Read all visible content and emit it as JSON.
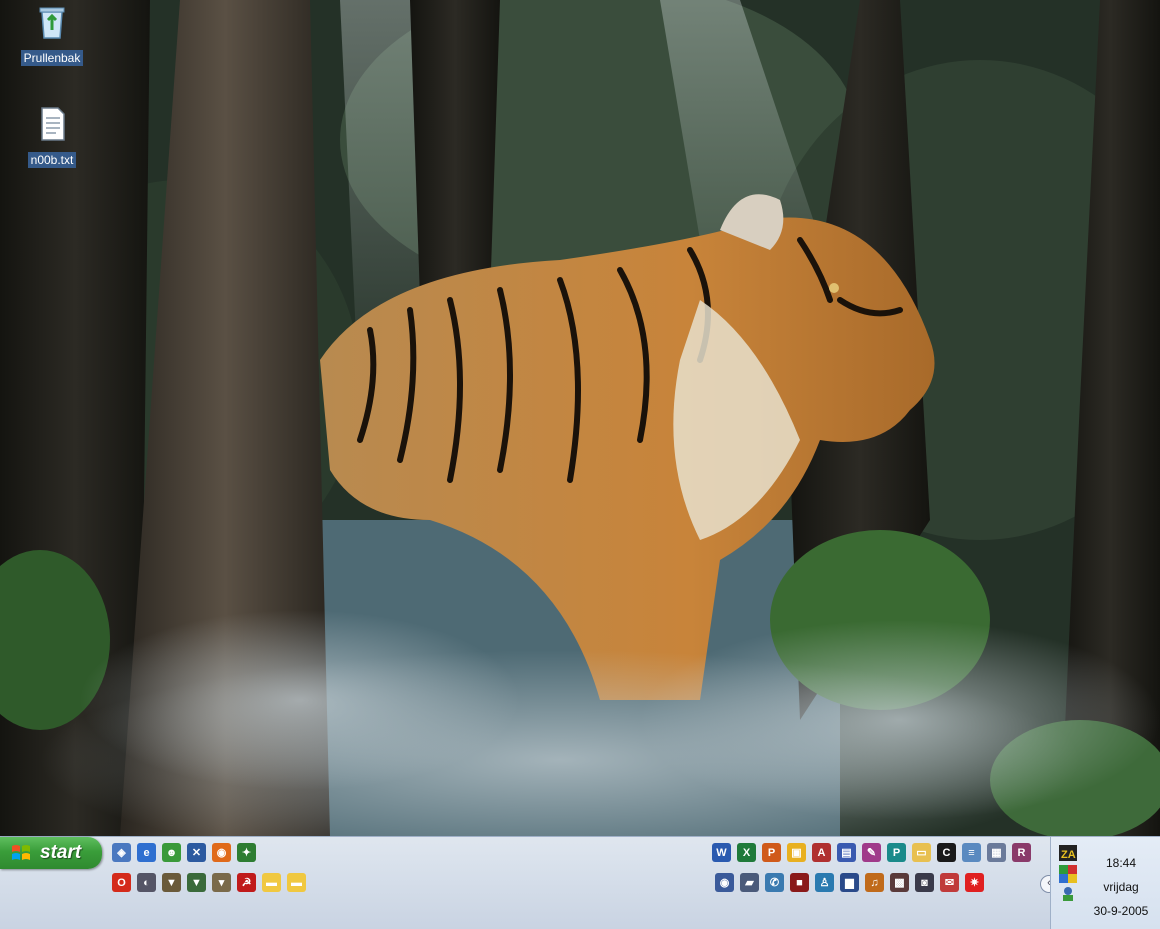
{
  "desktop": {
    "icons": [
      {
        "label": "Prullenbak",
        "icon": "recycle-bin-icon"
      },
      {
        "label": "n00b.txt",
        "icon": "text-file-icon"
      }
    ]
  },
  "taskbar": {
    "start_label": "start",
    "quick_launch_row1": [
      {
        "icon": "network-icon",
        "color": "#4a78c0",
        "glyph": "◈"
      },
      {
        "icon": "internet-explorer-icon",
        "color": "#2f6fd0",
        "glyph": "e"
      },
      {
        "icon": "messenger-icon",
        "color": "#3a9a3a",
        "glyph": "☻"
      },
      {
        "icon": "tool-icon",
        "color": "#2c5aa0",
        "glyph": "✕"
      },
      {
        "icon": "firefox-icon",
        "color": "#e06a1a",
        "glyph": "◉"
      },
      {
        "icon": "game-icon",
        "color": "#2e7d32",
        "glyph": "✦"
      }
    ],
    "quick_launch_row2": [
      {
        "icon": "opera-icon",
        "color": "#d42a1a",
        "glyph": "O"
      },
      {
        "icon": "media-icon",
        "color": "#555566",
        "glyph": "◐"
      },
      {
        "icon": "game-wings-icon",
        "color": "#6a5a3a",
        "glyph": "▼"
      },
      {
        "icon": "game-emblem-icon",
        "color": "#3a6a3a",
        "glyph": "▼"
      },
      {
        "icon": "game-wings2-icon",
        "color": "#7a6a4a",
        "glyph": "▾"
      },
      {
        "icon": "hammer-sickle-icon",
        "color": "#c01a1a",
        "glyph": "☭"
      },
      {
        "icon": "folder-icon",
        "color": "#f0c840",
        "glyph": "▬"
      },
      {
        "icon": "folder2-icon",
        "color": "#f0c840",
        "glyph": "▬"
      }
    ],
    "apps_row1": [
      {
        "icon": "word-icon",
        "color": "#2a5ab0",
        "glyph": "W"
      },
      {
        "icon": "excel-icon",
        "color": "#1f7a3a",
        "glyph": "X"
      },
      {
        "icon": "powerpoint-icon",
        "color": "#d05a1a",
        "glyph": "P"
      },
      {
        "icon": "app-yellow-icon",
        "color": "#e8b020",
        "glyph": "▣"
      },
      {
        "icon": "access-icon",
        "color": "#b03030",
        "glyph": "A"
      },
      {
        "icon": "app-blue-icon",
        "color": "#3a5ab0",
        "glyph": "▤"
      },
      {
        "icon": "paint-icon",
        "color": "#a03a8a",
        "glyph": "✎"
      },
      {
        "icon": "publisher-icon",
        "color": "#1a8a8a",
        "glyph": "P"
      },
      {
        "icon": "folder-open-icon",
        "color": "#e8c050",
        "glyph": "▭"
      },
      {
        "icon": "command-prompt-icon",
        "color": "#1a1a1a",
        "glyph": "C"
      },
      {
        "icon": "notepad-icon",
        "color": "#5a8ac0",
        "glyph": "≡"
      },
      {
        "icon": "calculator-icon",
        "color": "#6a7a9a",
        "glyph": "▦"
      },
      {
        "icon": "winrar-icon",
        "color": "#8a3a6a",
        "glyph": "R"
      }
    ],
    "apps_row2": [
      {
        "icon": "player-icon",
        "color": "#3a5a9a",
        "glyph": "◉"
      },
      {
        "icon": "truck-icon",
        "color": "#4a5a7a",
        "glyph": "▰"
      },
      {
        "icon": "chat-icon",
        "color": "#3a7ab0",
        "glyph": "✆"
      },
      {
        "icon": "red-black-icon",
        "color": "#8a1a1a",
        "glyph": "■"
      },
      {
        "icon": "figure-icon",
        "color": "#2a7ab0",
        "glyph": "♙"
      },
      {
        "icon": "monitor-icon",
        "color": "#2a4a8a",
        "glyph": "▆"
      },
      {
        "icon": "headphones-icon",
        "color": "#c06a1a",
        "glyph": "♫"
      },
      {
        "icon": "film-icon",
        "color": "#5a3a3a",
        "glyph": "▩"
      },
      {
        "icon": "camera-icon",
        "color": "#3a3a4a",
        "glyph": "◙"
      },
      {
        "icon": "mail-icon",
        "color": "#c03a3a",
        "glyph": "✉"
      },
      {
        "icon": "star-burst-icon",
        "color": "#e02020",
        "glyph": "✷"
      }
    ]
  },
  "tray": {
    "time": "18:44",
    "day": "vrijdag",
    "date": "30-9-2005"
  }
}
